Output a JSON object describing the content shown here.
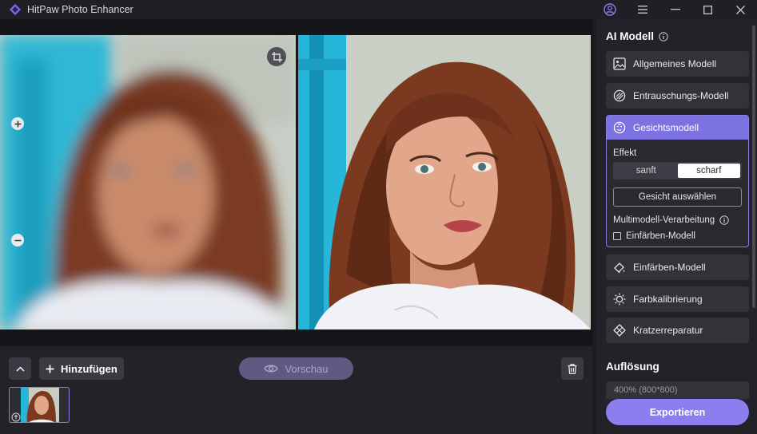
{
  "app": {
    "title": "HitPaw Photo Enhancer"
  },
  "toolbar": {
    "add_label": "Hinzufügen",
    "preview_label": "Vorschau"
  },
  "panel": {
    "ai_model_title": "AI Modell",
    "models": [
      {
        "label": "Allgemeines Modell",
        "icon": "image-icon"
      },
      {
        "label": "Entrauschungs-Modell",
        "icon": "denoise-icon"
      },
      {
        "label": "Gesichtsmodell",
        "icon": "face-icon"
      },
      {
        "label": "Einfärben-Modell",
        "icon": "colorize-icon"
      },
      {
        "label": "Farbkalibrierung",
        "icon": "color-calibration-icon"
      },
      {
        "label": "Kratzerreparatur",
        "icon": "scratch-repair-icon"
      }
    ],
    "face_settings": {
      "effect_label": "Effekt",
      "option_soft": "sanft",
      "option_sharp": "scharf",
      "selected": "scharf",
      "select_face_label": "Gesicht auswählen",
      "multimodel_label": "Multimodell-Verarbeitung",
      "colorize_checkbox_label": "Einfärben-Modell",
      "colorize_checked": false
    },
    "resolution_title": "Auflösung",
    "resolution_value": "400% (800*800)",
    "export_label": "Exportieren"
  },
  "colors": {
    "accent": "#8b7ff0",
    "accent_header": "#7d73e0",
    "panel_bg": "#222228",
    "card_bg": "#323239"
  }
}
